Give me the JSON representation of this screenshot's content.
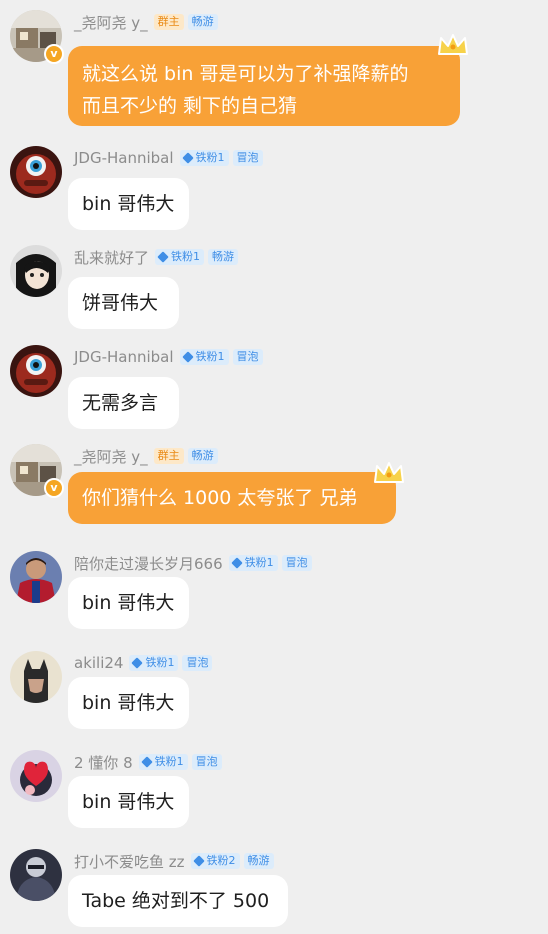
{
  "colors": {
    "background": "#efefef",
    "owner_bubble": "#f8a137",
    "member_bubble": "#ffffff",
    "fan_tag": "#3f8ee6",
    "owner_tag": "#e98a15"
  },
  "messages": [
    {
      "username": "_尧阿尧 y_",
      "avatar_icon": "room-photo-avatar-icon",
      "verified_badge": "v",
      "tags": [
        "群主",
        "畅游"
      ],
      "text_line1": "就这么说  bin 哥是可以为了补强降薪的",
      "text_line2": "而且不少的  剩下的自己猜",
      "crown_icon": "crown-icon"
    },
    {
      "username": "JDG-Hannibal",
      "avatar_icon": "one-eyed-monster-avatar-icon",
      "tags": [
        "铁粉1",
        "冒泡"
      ],
      "text": "bin 哥伟大"
    },
    {
      "username": "乱来就好了",
      "avatar_icon": "anime-face-avatar-icon",
      "tags": [
        "铁粉1",
        "畅游"
      ],
      "text": "饼哥伟大"
    },
    {
      "username": "JDG-Hannibal",
      "avatar_icon": "one-eyed-monster-avatar-icon",
      "tags": [
        "铁粉1",
        "冒泡"
      ],
      "text": "无需多言"
    },
    {
      "username": "_尧阿尧 y_",
      "avatar_icon": "room-photo-avatar-icon",
      "verified_badge": "v",
      "tags": [
        "群主",
        "畅游"
      ],
      "text": "你们猜什么 1000  太夸张了  兄弟",
      "crown_icon": "crown-icon"
    },
    {
      "username": "陪你走过漫长岁月666",
      "avatar_icon": "football-player-avatar-icon",
      "tags": [
        "铁粉1",
        "冒泡"
      ],
      "text": "bin 哥伟大"
    },
    {
      "username": "akili24",
      "avatar_icon": "batman-avatar-icon",
      "tags": [
        "铁粉1",
        "冒泡"
      ],
      "text": "bin 哥伟大"
    },
    {
      "username": "2 懂你 8",
      "avatar_icon": "red-heart-avatar-icon",
      "tags": [
        "铁粉1",
        "冒泡"
      ],
      "text": "bin 哥伟大"
    },
    {
      "username": "打小不爱吃鱼 zz",
      "avatar_icon": "dark-figure-avatar-icon",
      "tags": [
        "铁粉2",
        "畅游"
      ],
      "text": "Tabe 绝对到不了 500"
    }
  ]
}
